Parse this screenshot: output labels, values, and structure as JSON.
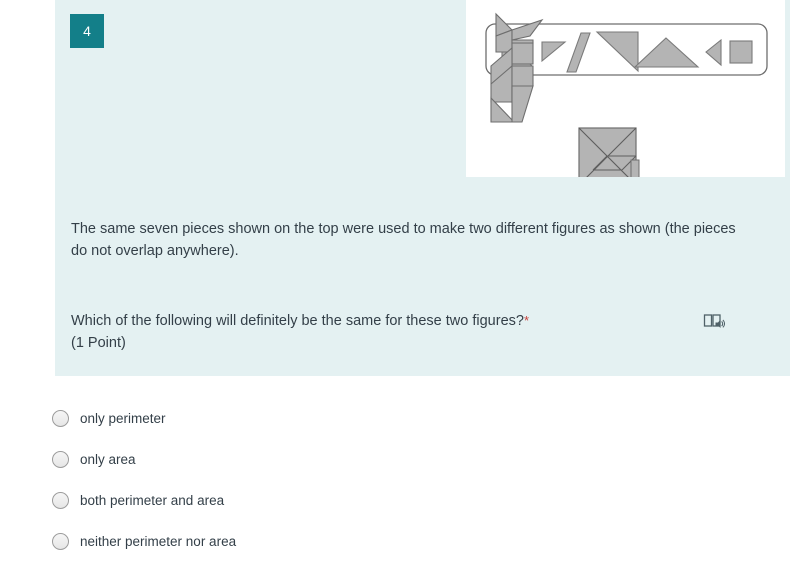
{
  "card": {
    "question_number": "4",
    "background_color": "#e4f1f2",
    "badge_color": "#137f89"
  },
  "question": {
    "description": "The same seven pieces shown on the top were used to make two different figures as shown (the pieces do not overlap anywhere).",
    "prompt": "Which of the following will definitely be the same for these two figures?",
    "required_marker": "*",
    "points": "(1 Point)",
    "read_aloud_icon": "read-aloud-speaker-icon",
    "required_color": "#c8413b"
  },
  "figure": {
    "alt": "Seven tangram pieces shown in a rounded outline box, and two different figures assembled from those pieces",
    "piece_fill": "#b4b4b4",
    "piece_stroke": "#7a7a7a",
    "pieces": [
      "large-right-triangle",
      "small-right-triangle",
      "parallelogram",
      "large-right-triangle",
      "medium-triangle",
      "small-left-triangle",
      "square"
    ],
    "assembled_figures": [
      "abstract-vertical-figure",
      "square-figure"
    ]
  },
  "options": [
    {
      "label": "only perimeter",
      "selected": false
    },
    {
      "label": "only area",
      "selected": false
    },
    {
      "label": "both perimeter and area",
      "selected": false
    },
    {
      "label": "neither perimeter nor area",
      "selected": false
    }
  ]
}
